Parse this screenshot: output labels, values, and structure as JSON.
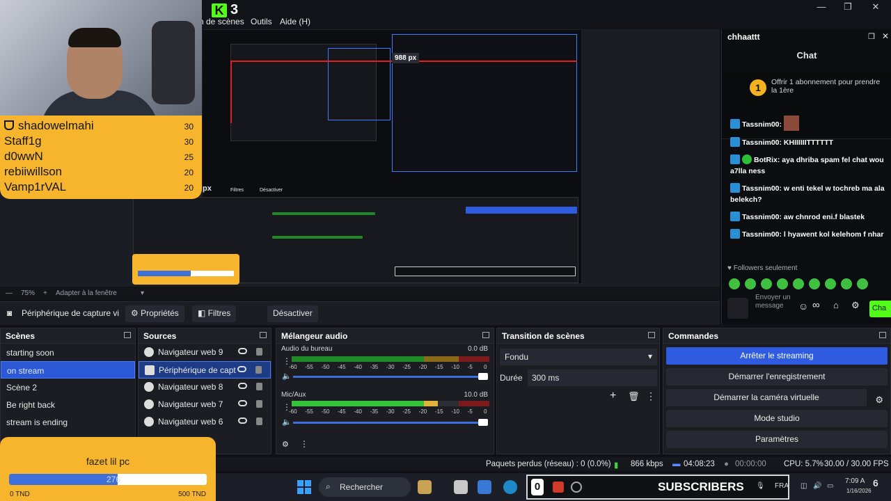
{
  "menu": {
    "version": "3",
    "items": [
      "n de scènes",
      "Outils",
      "Aide (H)"
    ]
  },
  "preview": {
    "dimension_badge": "988 px",
    "px_label": "px",
    "filters_mini": "Filtres",
    "deactivate_mini": "Désactiver"
  },
  "leaderboard": [
    {
      "name": "shadowelmahi",
      "value": "30"
    },
    {
      "name": "Staff1g",
      "value": "30"
    },
    {
      "name": "d0wwN",
      "value": "25"
    },
    {
      "name": "rebiiwillson",
      "value": "20"
    },
    {
      "name": "Vamp1rVAL",
      "value": "20"
    }
  ],
  "zoom": {
    "minus": "—",
    "percent": "75%",
    "plus": "+",
    "fit": "Adapter à la fenêtre"
  },
  "source_toolbar": {
    "source_name": "Périphérique de capture vi",
    "properties": "Propriétés",
    "filters": "Filtres",
    "deactivate": "Désactiver"
  },
  "chat": {
    "header": "chhaattt",
    "title": "Chat",
    "promo": "Offrir 1 abonnement pour prendre la 1ère",
    "messages": [
      {
        "user": "Tassnim00:",
        "text": ""
      },
      {
        "user": "Tassnim00:",
        "text": "KHIIIIIITTTTTT"
      },
      {
        "user": "BotRix:",
        "text": "aya dhriba spam fel chat wou a7lla ness"
      },
      {
        "user": "Tassnim00:",
        "text": "w enti tekel w tochreb ma ala belekch?"
      },
      {
        "user": "Tassnim00:",
        "text": "aw chnrod eni.f blastek"
      },
      {
        "user": "Tassnim00:",
        "text": "l hyawent kol kelehom f nhar"
      }
    ],
    "followers_only": "Followers seulement",
    "input_placeholder": "Envoyer un message",
    "send_label": "Cha"
  },
  "docks": {
    "scenes": {
      "title": "Scènes",
      "items": [
        "starting soon",
        "on stream",
        "Scène 2",
        "Be right back",
        "stream is ending"
      ],
      "selected": 1
    },
    "sources": {
      "title": "Sources",
      "items": [
        "Navigateur web 9",
        "Périphérique de capt",
        "Navigateur web 8",
        "Navigateur web 7",
        "Navigateur web 6"
      ],
      "selected": 1
    },
    "mixer": {
      "title": "Mélangeur audio",
      "channels": [
        {
          "name": "Audio du bureau",
          "db": "0.0 dB"
        },
        {
          "name": "Mic/Aux",
          "db": "10.0 dB"
        }
      ],
      "ticks": [
        "-60",
        "-55",
        "-50",
        "-45",
        "-40",
        "-35",
        "-30",
        "-25",
        "-20",
        "-15",
        "-10",
        "-5",
        "0"
      ]
    },
    "transitions": {
      "title": "Transition de scènes",
      "type": "Fondu",
      "duration_label": "Durée",
      "duration_value": "300 ms"
    },
    "commands": {
      "title": "Commandes",
      "buttons": [
        "Arrêter le streaming",
        "Démarrer l'enregistrement",
        "Démarrer la caméra virtuelle",
        "Mode studio",
        "Paramètres"
      ]
    }
  },
  "goal": {
    "title": "fazet lil pc",
    "current": "276",
    "progress": 0.55,
    "min": "0 TND",
    "max": "500 TND"
  },
  "status": {
    "dropped": "Paquets perdus (réseau) : 0 (0.0%)",
    "bitrate": "866 kbps",
    "live_time": "04:08:23",
    "rec_time": "00:00:00",
    "cpu": "CPU: 5.7%",
    "fps": "30.00 / 30.00 FPS"
  },
  "taskbar": {
    "search": "Rechercher",
    "subs_count": "0",
    "subs_label": "SUBSCRIBERS",
    "lang": "FRA",
    "time": "7:09 A",
    "date": "1/16/2026",
    "notif": "6"
  },
  "colors": {
    "accent": "#2f5be0",
    "kick_green": "#53fc18",
    "overlay_orange": "#f6b52d"
  }
}
